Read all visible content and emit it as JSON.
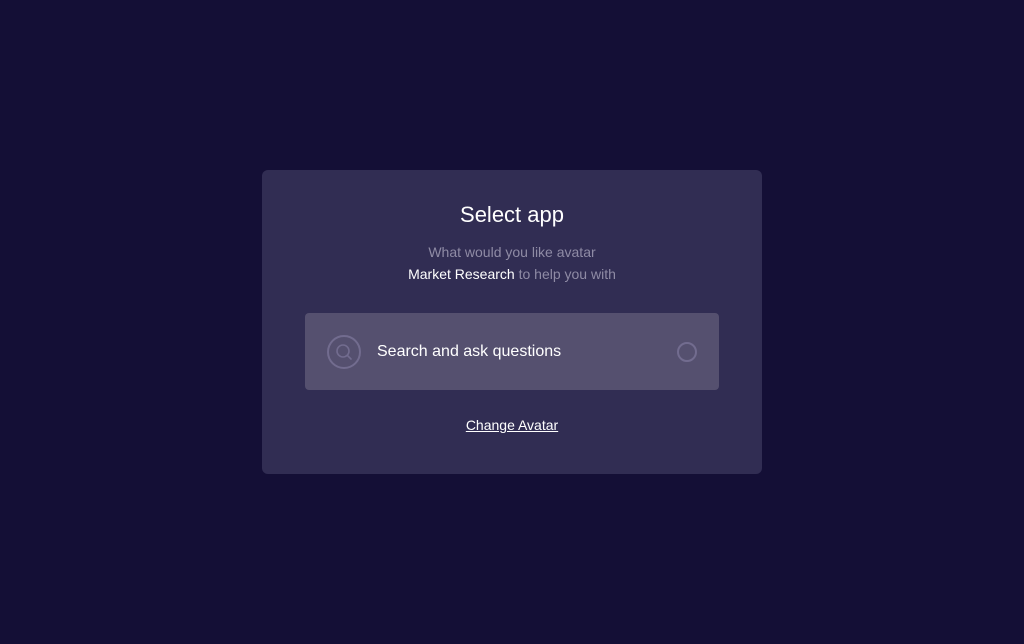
{
  "dialog": {
    "title": "Select app",
    "subtitle_line1": "What would you like avatar",
    "avatar_name": "Market Research",
    "subtitle_line2_suffix": " to help you with"
  },
  "options": [
    {
      "label": "Search and ask questions",
      "icon": "search-icon",
      "selected": false
    }
  ],
  "change_avatar_label": "Change Avatar",
  "colors": {
    "background": "#140f36",
    "card": "#312d53",
    "option": "#55506f",
    "muted_text": "#8f8ba5",
    "icon_stroke": "#726c8f"
  }
}
